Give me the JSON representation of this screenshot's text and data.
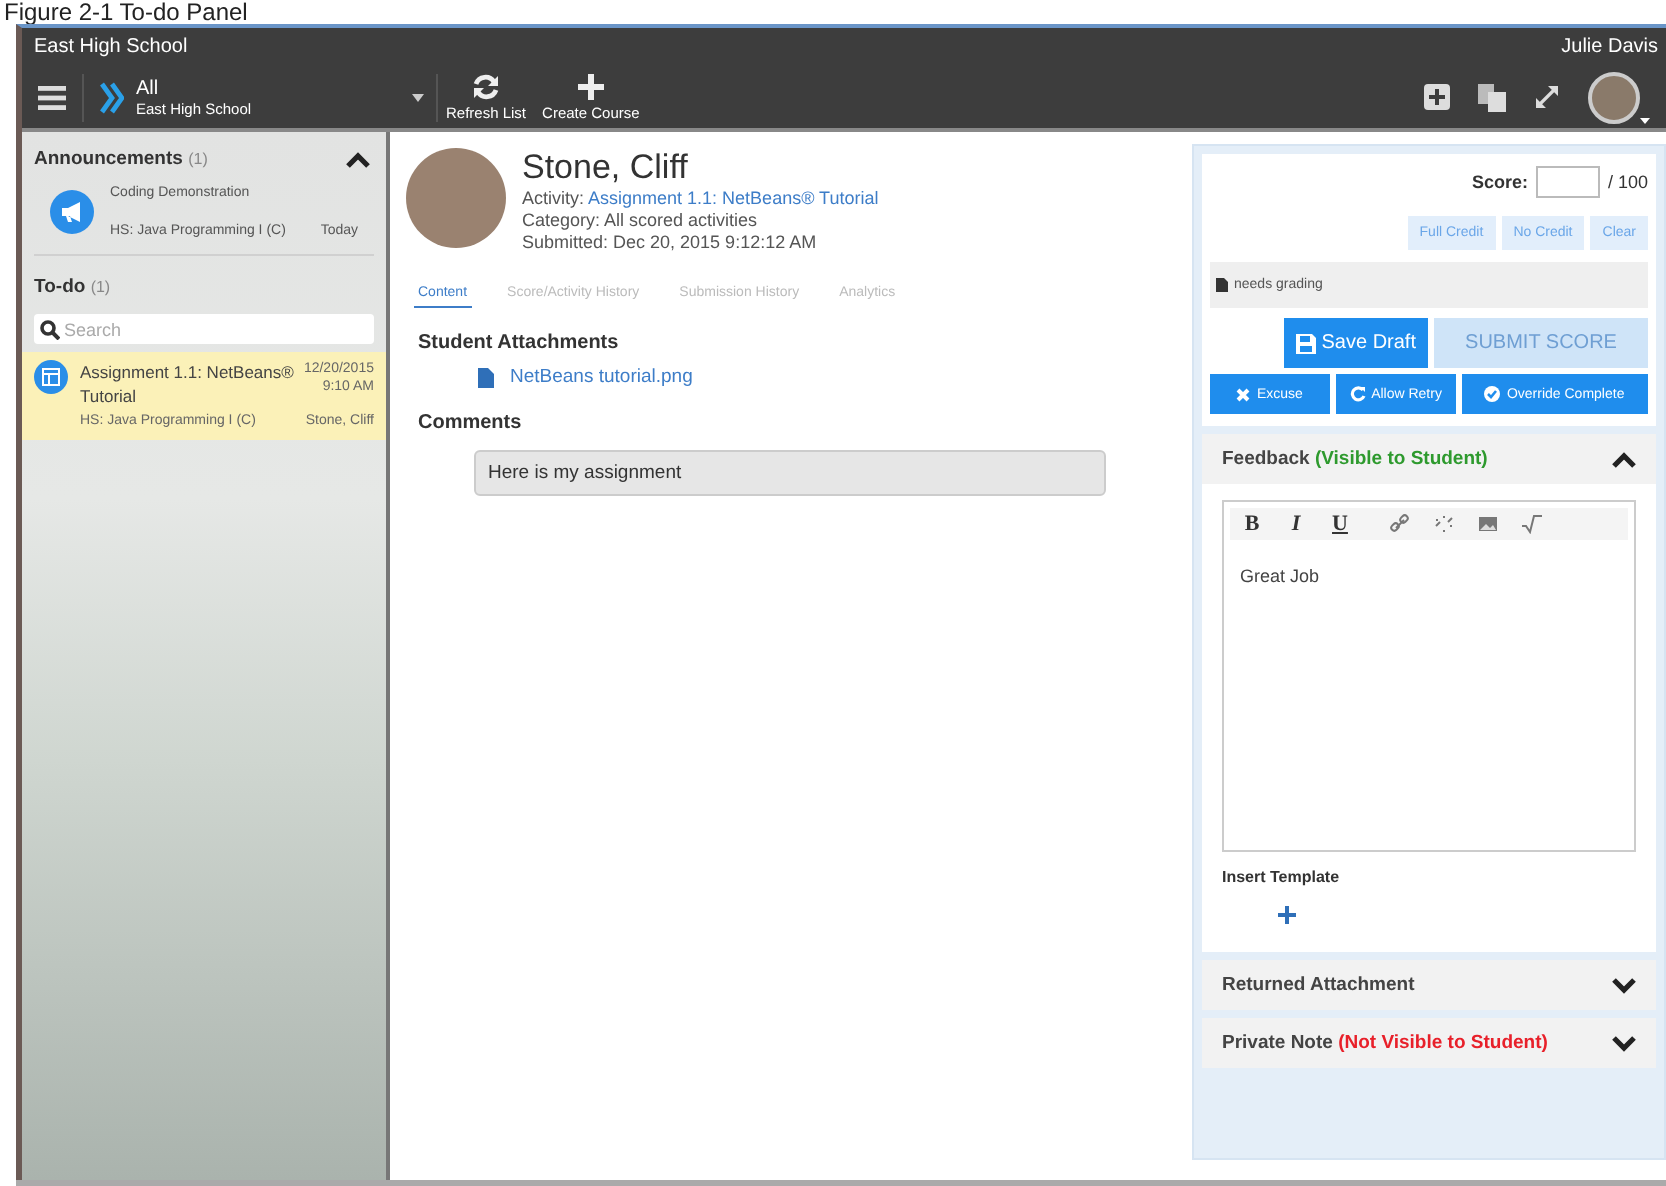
{
  "caption": "Figure 2-1 To-do Panel",
  "window": {
    "title": "East High School",
    "user": "Julie Davis"
  },
  "toolbar": {
    "scope_title": "All",
    "scope_subtitle": "East High School",
    "actions": [
      {
        "label": "Refresh List",
        "kind": "refresh"
      },
      {
        "label": "Create Course",
        "kind": "add"
      }
    ]
  },
  "sidebar": {
    "announcements": {
      "title": "Announcements",
      "count": "(1)",
      "expanded": true,
      "items": [
        {
          "title": "Coding Demonstration",
          "course": "HS: Java Programming I (C)",
          "date": "Today"
        }
      ]
    },
    "todo": {
      "title": "To-do",
      "count": "(1)",
      "search": {
        "placeholder": "Search"
      },
      "items": [
        {
          "title": "Assignment 1.1: NetBeans® Tutorial",
          "course": "HS: Java Programming I (C)",
          "date": "12/20/2015",
          "time": "9:10 AM",
          "student": "Stone, Cliff",
          "selected": true
        }
      ]
    }
  },
  "submission": {
    "student": "Stone, Cliff",
    "activity_label": "Activity:",
    "activity": "Assignment 1.1: NetBeans® Tutorial",
    "category": "Category: All scored activities",
    "submitted": "Submitted: Dec 20, 2015 9:12:12 AM",
    "tabs": [
      {
        "label": "Content",
        "selected": true
      },
      {
        "label": "Score/Activity History",
        "selected": false
      },
      {
        "label": "Submission History",
        "selected": false
      },
      {
        "label": "Analytics",
        "selected": false
      }
    ],
    "attachments_title": "Student Attachments",
    "attachments": [
      "NetBeans tutorial.png"
    ],
    "comments_title": "Comments",
    "comment": "Here is my assignment"
  },
  "grading": {
    "score_label": "Score:",
    "score_max": "/ 100",
    "credit_buttons": [
      "Full Credit",
      "No Credit",
      "Clear"
    ],
    "status": "needs grading",
    "save_button": "Save Draft",
    "submit_button": {
      "label": "SUBMIT SCORE",
      "disabled": true
    },
    "actions": [
      {
        "label": "Excuse",
        "kind": "excuse"
      },
      {
        "label": "Allow Retry",
        "kind": "retry"
      },
      {
        "label": "Override Complete",
        "kind": "complete"
      }
    ],
    "sections": [
      {
        "kind": "editor",
        "title": "Feedback",
        "note": "(Visible to Student)",
        "color": "#2e9a2e",
        "expanded": true,
        "format_buttons": [
          "B",
          "I",
          "U"
        ],
        "text": "Great Job",
        "insert_template": "Insert Template"
      },
      {
        "kind": "plain",
        "title": "Returned Attachment",
        "expanded": false
      },
      {
        "kind": "plain",
        "title": "Private Note",
        "note": "(Not Visible to Student)",
        "color": "#e8202a",
        "expanded": false
      }
    ]
  }
}
